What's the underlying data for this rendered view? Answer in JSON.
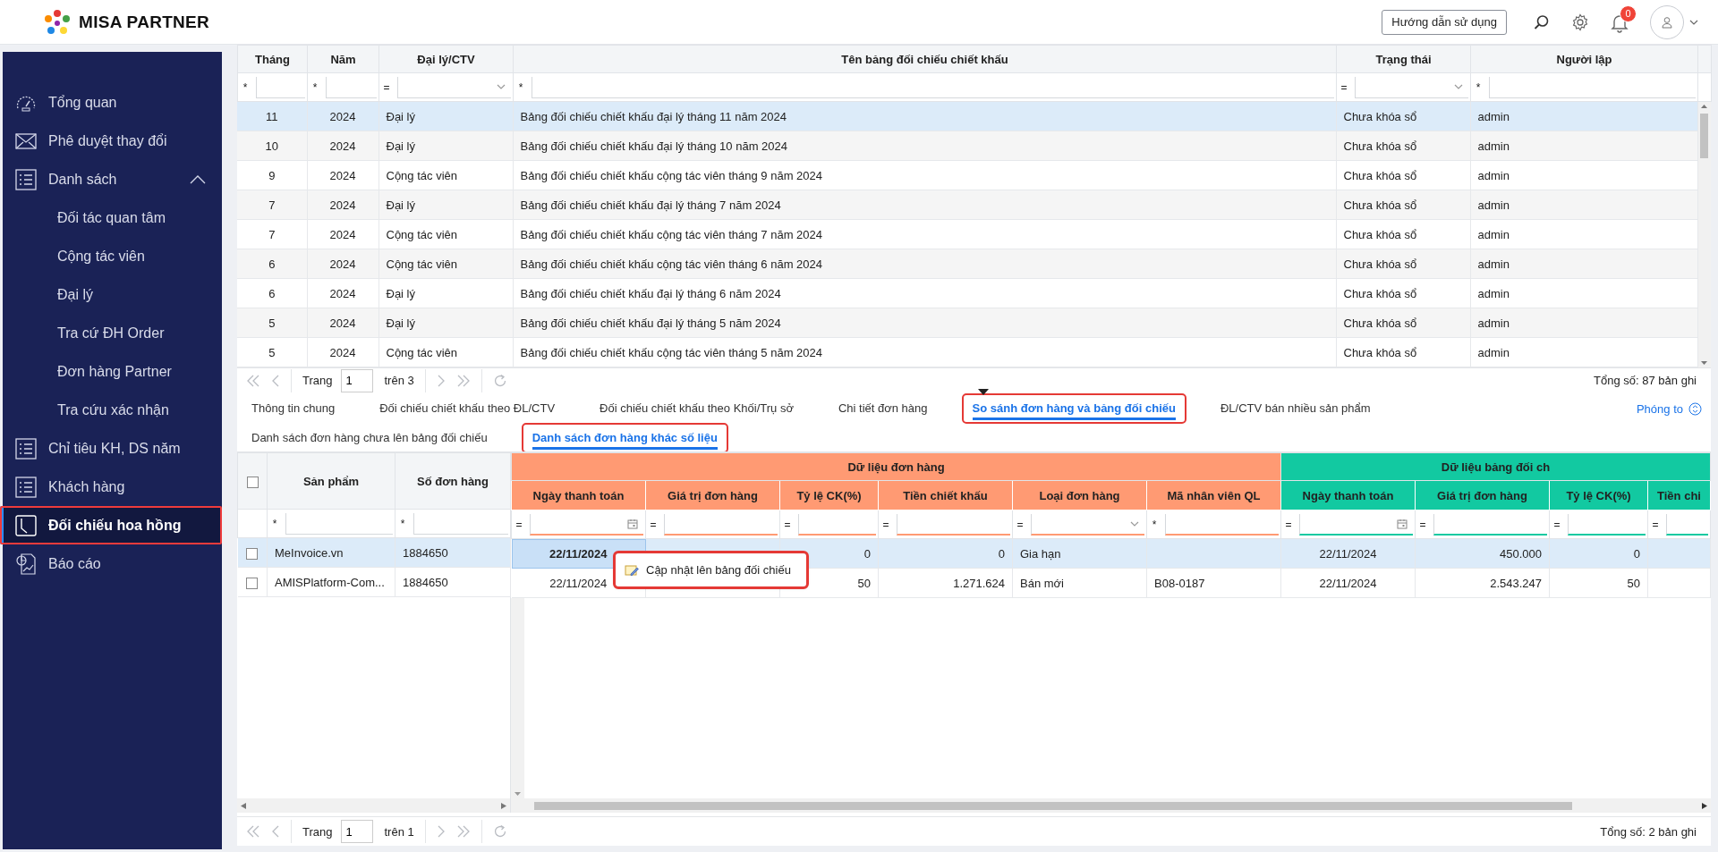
{
  "header": {
    "brand": "MISA PARTNER",
    "help_button": "Hướng dẫn sử dụng",
    "notification_count": "0"
  },
  "sidebar": {
    "items": [
      {
        "label": "Tổng quan",
        "selected": false,
        "highlighted": false
      },
      {
        "label": "Phê duyệt thay đổi",
        "selected": false,
        "highlighted": false
      },
      {
        "label": "Danh sách",
        "selected": false,
        "highlighted": false,
        "expanded": true,
        "children": [
          {
            "label": "Đối tác quan tâm",
            "selected": false
          },
          {
            "label": "Cộng tác viên",
            "selected": false
          },
          {
            "label": "Đại lý",
            "selected": false
          },
          {
            "label": "Tra cứ ĐH Order",
            "selected": false
          },
          {
            "label": "Đơn hàng Partner",
            "selected": false
          },
          {
            "label": "Tra cứu xác nhận",
            "selected": false
          }
        ]
      },
      {
        "label": "Chỉ tiêu KH, DS năm",
        "selected": false,
        "highlighted": false
      },
      {
        "label": "Khách hàng",
        "selected": false,
        "highlighted": false
      },
      {
        "label": "Đối chiếu hoa hồng",
        "selected": true,
        "highlighted": true
      },
      {
        "label": "Báo cáo",
        "selected": false,
        "highlighted": false
      }
    ]
  },
  "top_table": {
    "columns": [
      {
        "label": "Tháng",
        "filter": {
          "operator": "*",
          "kind": "text"
        }
      },
      {
        "label": "Năm",
        "filter": {
          "operator": "*",
          "kind": "text"
        }
      },
      {
        "label": "Đại lý/CTV",
        "filter": {
          "operator": "=",
          "kind": "select"
        }
      },
      {
        "label": "Tên bảng đối chiếu chiết khấu",
        "filter": {
          "operator": "*",
          "kind": "text"
        }
      },
      {
        "label": "Trạng thái",
        "filter": {
          "operator": "=",
          "kind": "select"
        }
      },
      {
        "label": "Người lập",
        "filter": {
          "operator": "*",
          "kind": "text"
        }
      }
    ],
    "rows": [
      {
        "selected": true,
        "cells": [
          "11",
          "2024",
          "Đại lý",
          "Bảng đối chiếu chiết khấu đại lý tháng 11 năm 2024",
          "Chưa khóa sổ",
          "admin"
        ]
      },
      {
        "selected": false,
        "cells": [
          "10",
          "2024",
          "Đại lý",
          "Bảng đối chiếu chiết khấu đại lý tháng 10 năm 2024",
          "Chưa khóa sổ",
          "admin"
        ]
      },
      {
        "selected": false,
        "cells": [
          "9",
          "2024",
          "Cộng tác viên",
          "Bảng đối chiếu chiết khấu cộng tác viên tháng 9 năm 2024",
          "Chưa khóa sổ",
          "admin"
        ]
      },
      {
        "selected": false,
        "cells": [
          "7",
          "2024",
          "Đại lý",
          "Bảng đối chiếu chiết khấu đại lý tháng 7 năm 2024",
          "Chưa khóa sổ",
          "admin"
        ]
      },
      {
        "selected": false,
        "cells": [
          "7",
          "2024",
          "Cộng tác viên",
          "Bảng đối chiếu chiết khấu cộng tác viên tháng 7 năm 2024",
          "Chưa khóa sổ",
          "admin"
        ]
      },
      {
        "selected": false,
        "cells": [
          "6",
          "2024",
          "Cộng tác viên",
          "Bảng đối chiếu chiết khấu cộng tác viên tháng 6 năm 2024",
          "Chưa khóa sổ",
          "admin"
        ]
      },
      {
        "selected": false,
        "cells": [
          "6",
          "2024",
          "Đại lý",
          "Bảng đối chiếu chiết khấu đại lý tháng 6 năm 2024",
          "Chưa khóa sổ",
          "admin"
        ]
      },
      {
        "selected": false,
        "cells": [
          "5",
          "2024",
          "Đại lý",
          "Bảng đối chiếu chiết khấu đại lý tháng 5 năm 2024",
          "Chưa khóa sổ",
          "admin"
        ]
      },
      {
        "selected": false,
        "cells": [
          "5",
          "2024",
          "Cộng tác viên",
          "Bảng đối chiếu chiết khấu cộng tác viên tháng 5 năm 2024",
          "Chưa khóa sổ",
          "admin"
        ]
      }
    ],
    "pager": {
      "page_label": "Trang",
      "page": "1",
      "page_count": "trên 3",
      "total": "Tổng số: 87 bản ghi"
    }
  },
  "tabs": {
    "items": [
      {
        "label": "Thông tin chung",
        "selected": false,
        "highlighted": false
      },
      {
        "label": "Đối chiếu chiết khấu theo ĐL/CTV",
        "selected": false,
        "highlighted": false
      },
      {
        "label": "Đối chiếu chiết khấu theo Khối/Trụ sở",
        "selected": false,
        "highlighted": false
      },
      {
        "label": "Chi tiết đơn hàng",
        "selected": false,
        "highlighted": false
      },
      {
        "label": "So sánh đơn hàng và bảng đối chiếu",
        "selected": true,
        "highlighted": true
      },
      {
        "label": "ĐL/CTV bán nhiều sản phẩm",
        "selected": false,
        "highlighted": false
      }
    ],
    "zoom_label": "Phóng to"
  },
  "subtabs": {
    "items": [
      {
        "label": "Danh sách đơn hàng chưa lên bảng đối chiếu",
        "selected": false,
        "highlighted": false
      },
      {
        "label": "Danh sách đơn hàng khác số liệu",
        "selected": true,
        "highlighted": true
      }
    ]
  },
  "compare_grid": {
    "select_all_checked": false,
    "frozen_columns": [
      {
        "label": "Sản phẩm",
        "filter": {
          "operator": "*",
          "kind": "text"
        }
      },
      {
        "label": "Số đơn hàng",
        "filter": {
          "operator": "*",
          "kind": "text"
        }
      }
    ],
    "groups": [
      {
        "label": "Dữ liệu đơn hàng",
        "color": "#ff9a73",
        "columns": [
          {
            "label": "Ngày thanh toán",
            "filter": {
              "operator": "=",
              "kind": "date"
            }
          },
          {
            "label": "Giá trị đơn hàng",
            "filter": {
              "operator": "=",
              "kind": "text"
            }
          },
          {
            "label": "Tỷ lệ CK(%)",
            "filter": {
              "operator": "=",
              "kind": "text"
            }
          },
          {
            "label": "Tiền chiết khấu",
            "filter": {
              "operator": "=",
              "kind": "text"
            }
          },
          {
            "label": "Loại đơn hàng",
            "filter": {
              "operator": "=",
              "kind": "select"
            }
          },
          {
            "label": "Mã nhân viên QL",
            "filter": {
              "operator": "*",
              "kind": "text"
            }
          }
        ]
      },
      {
        "label": "Dữ liệu bảng đối ch",
        "color": "#12c9a1",
        "columns": [
          {
            "label": "Ngày thanh toán",
            "filter": {
              "operator": "=",
              "kind": "date"
            }
          },
          {
            "label": "Giá trị đơn hàng",
            "filter": {
              "operator": "=",
              "kind": "text"
            }
          },
          {
            "label": "Tỷ lệ CK(%)",
            "filter": {
              "operator": "=",
              "kind": "text"
            }
          },
          {
            "label": "Tiền chi",
            "filter": {
              "operator": "=",
              "kind": "text"
            }
          }
        ]
      }
    ],
    "rows": [
      {
        "checked": false,
        "selected": true,
        "cells": [
          {
            "text": "MeInvoice.vn",
            "focused": false
          },
          {
            "text": "1884650",
            "focused": false
          },
          {
            "text": "22/11/2024",
            "focused": true
          },
          {
            "focused": false
          },
          {
            "text": "0",
            "focused": false
          },
          {
            "text": "0",
            "focused": false
          },
          {
            "text": "Gia hạn",
            "focused": false
          },
          {
            "focused": false
          },
          {
            "text": "22/11/2024",
            "focused": false
          },
          {
            "text": "450.000",
            "focused": false
          },
          {
            "text": "0",
            "focused": false
          },
          {
            "focused": false
          }
        ]
      },
      {
        "checked": false,
        "selected": false,
        "cells": [
          {
            "text": "AMISPlatform-Com...",
            "focused": false
          },
          {
            "text": "1884650",
            "focused": false
          },
          {
            "text": "22/11/2024",
            "focused": false
          },
          {
            "focused": false
          },
          {
            "text": "50",
            "focused": false
          },
          {
            "text": "1.271.624",
            "focused": false
          },
          {
            "text": "Bán mới",
            "focused": false
          },
          {
            "text": "B08-0187",
            "focused": false
          },
          {
            "text": "22/11/2024",
            "focused": false
          },
          {
            "text": "2.543.247",
            "focused": false
          },
          {
            "text": "50",
            "focused": false
          },
          {
            "focused": false
          }
        ]
      }
    ],
    "context_menu": {
      "label": "Cập nhật lên bảng đối chiếu",
      "highlighted": true
    },
    "pager": {
      "page_label": "Trang",
      "page": "1",
      "page_count": "trên 1",
      "total": "Tổng số: 2 bản ghi"
    }
  }
}
